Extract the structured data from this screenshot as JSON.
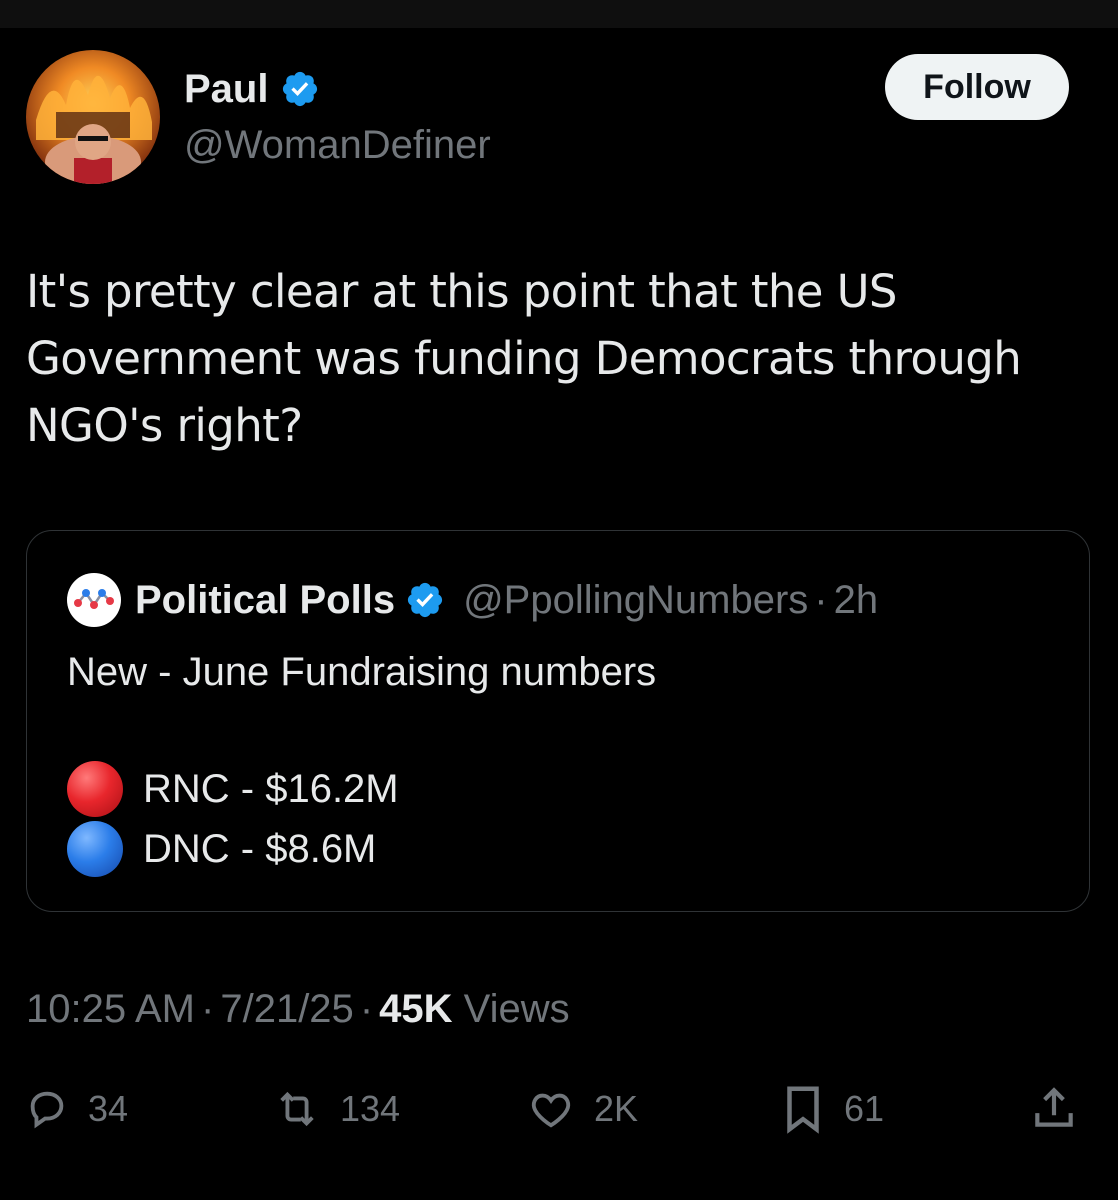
{
  "colors": {
    "background": "#000000",
    "text_primary": "#e7e9ea",
    "text_secondary": "#71767b",
    "verified": "#1d9bf0",
    "border": "#2f3336",
    "follow_bg": "#eff3f4"
  },
  "author": {
    "name": "Paul",
    "handle": "@WomanDefiner",
    "verified_icon": "verified-badge-icon"
  },
  "follow_button": {
    "label": "Follow"
  },
  "tweet": {
    "text": "It's pretty clear at this point that the US Government was funding Democrats through NGO's right?"
  },
  "quote": {
    "name": "Political Polls",
    "handle": "@PpollingNumbers",
    "separator": "·",
    "time": "2h",
    "line1": "New - June Fundraising numbers",
    "line2": "RNC - $16.2M",
    "line3": "DNC - $8.6M"
  },
  "meta": {
    "time": "10:25 AM",
    "separator": "·",
    "date": "7/21/25",
    "views_count": "45K",
    "views_label": "Views"
  },
  "actions": {
    "replies": "34",
    "reposts": "134",
    "likes": "2K",
    "bookmarks": "61"
  }
}
